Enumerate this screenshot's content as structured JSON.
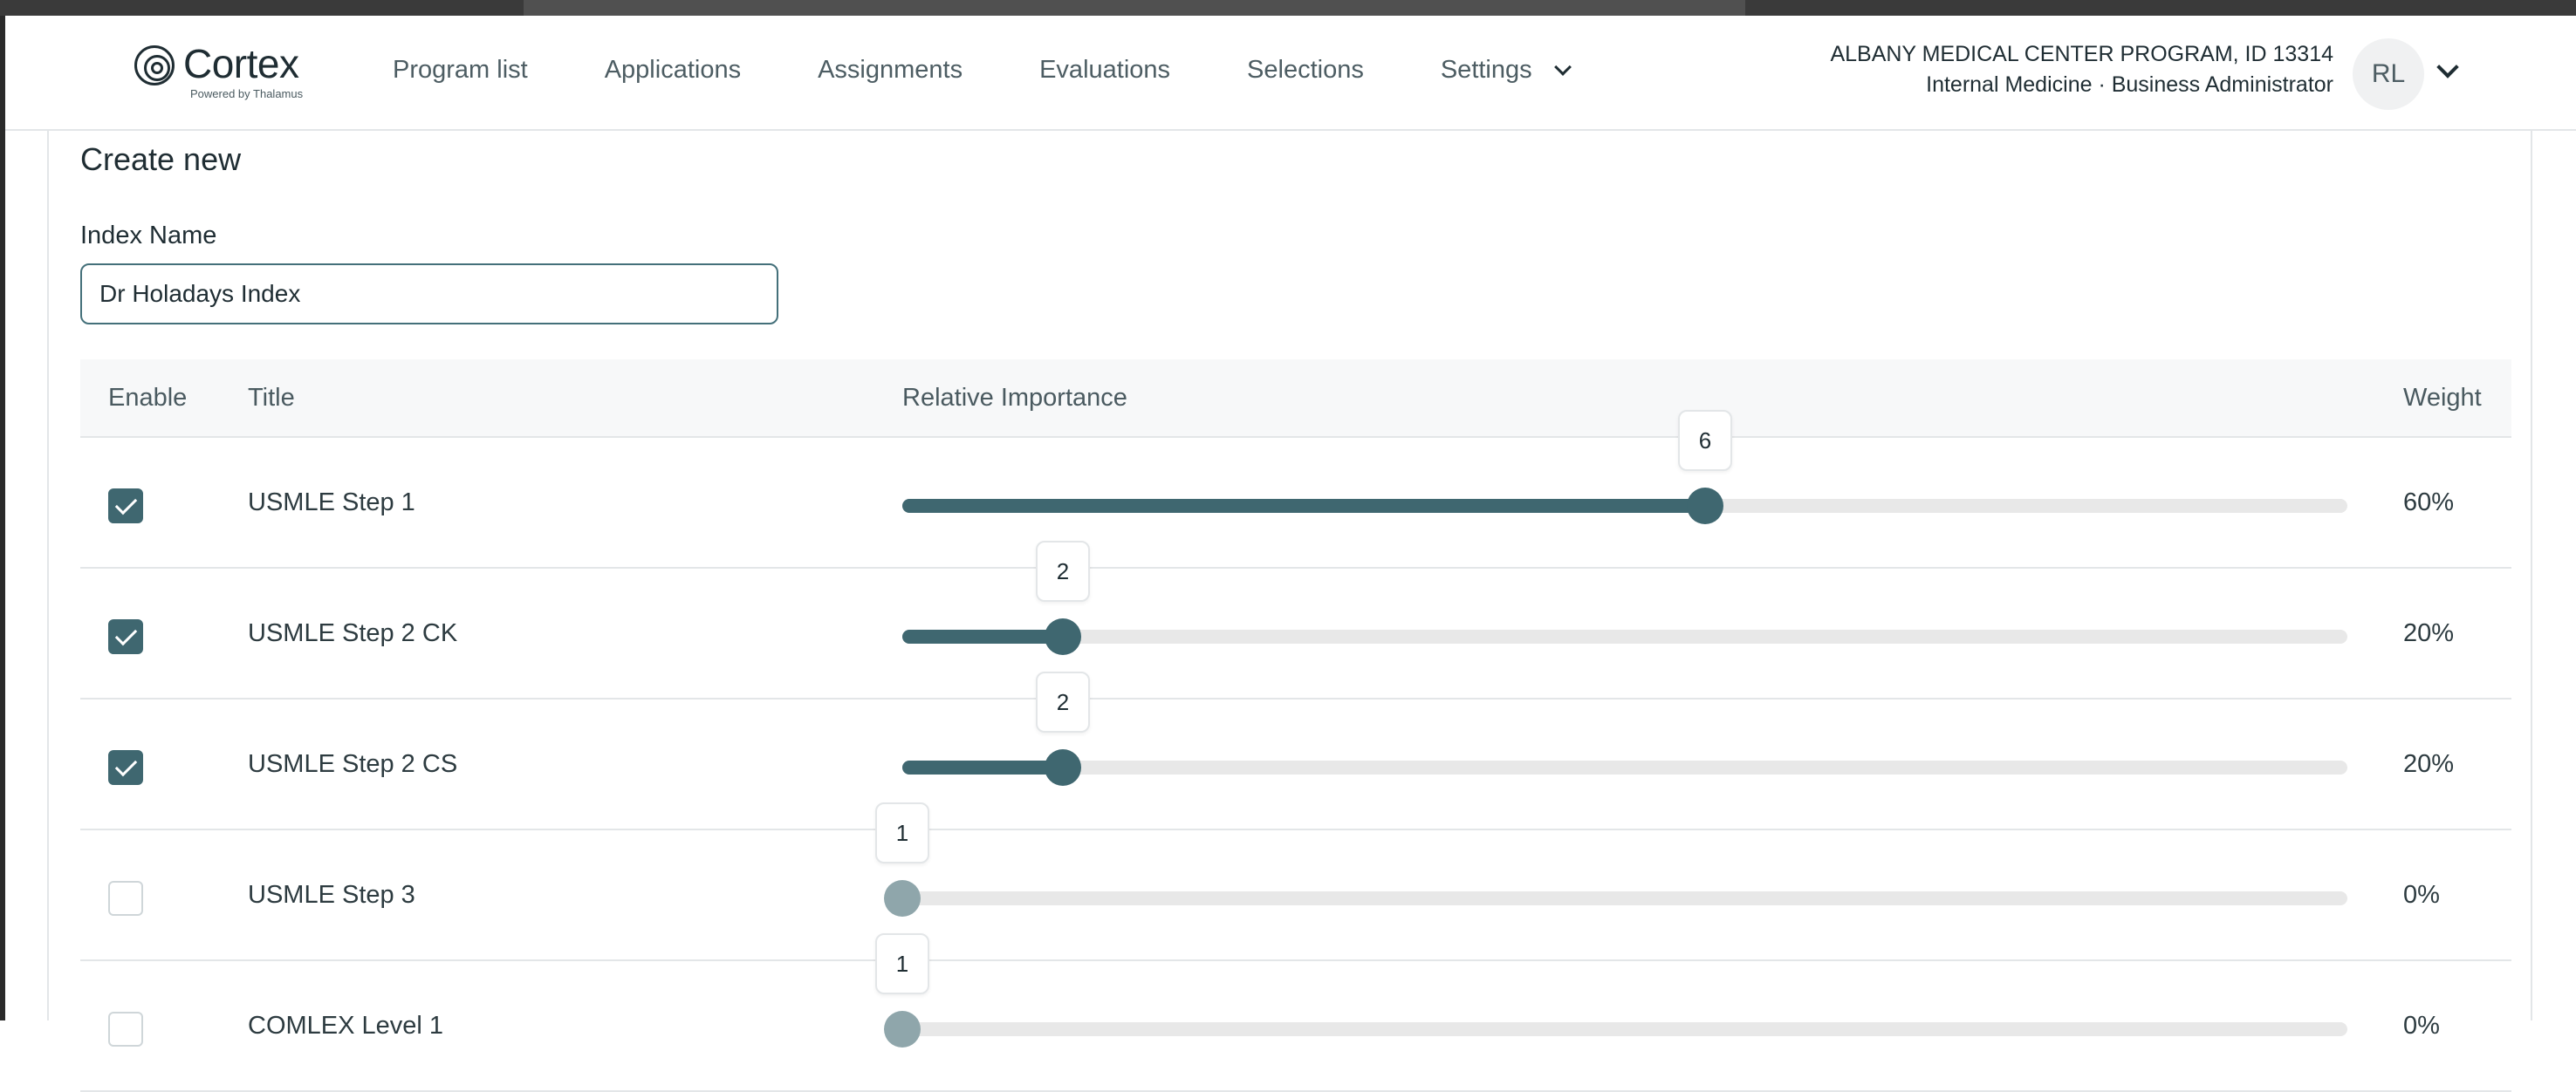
{
  "app": {
    "logo_text": "Cortex",
    "logo_subtext": "Powered by Thalamus"
  },
  "nav": {
    "items": [
      "Program list",
      "Applications",
      "Assignments",
      "Evaluations",
      "Selections",
      "Settings"
    ]
  },
  "account": {
    "program": "ALBANY MEDICAL CENTER PROGRAM, ID 13314",
    "role": "Internal Medicine · Business Administrator",
    "initials": "RL"
  },
  "form": {
    "title": "Create new",
    "index_name_label": "Index Name",
    "index_name_value": "Dr Holadays Index"
  },
  "table": {
    "headers": {
      "enable": "Enable",
      "title": "Title",
      "importance": "Relative Importance",
      "weight": "Weight"
    },
    "slider_max": 10,
    "rows": [
      {
        "enabled": true,
        "title": "USMLE Step 1",
        "importance": 6,
        "importance_label": "6",
        "weight": "60%"
      },
      {
        "enabled": true,
        "title": "USMLE Step 2 CK",
        "importance": 2,
        "importance_label": "2",
        "weight": "20%"
      },
      {
        "enabled": true,
        "title": "USMLE Step 2 CS",
        "importance": 2,
        "importance_label": "2",
        "weight": "20%"
      },
      {
        "enabled": false,
        "title": "USMLE Step 3",
        "importance": 1,
        "importance_label": "1",
        "weight": "0%"
      },
      {
        "enabled": false,
        "title": "COMLEX Level 1",
        "importance": 1,
        "importance_label": "1",
        "weight": "0%"
      }
    ]
  },
  "colors": {
    "accent": "#3f6770",
    "disabled_thumb": "#8fa6ab",
    "track": "#e8e8e8"
  }
}
